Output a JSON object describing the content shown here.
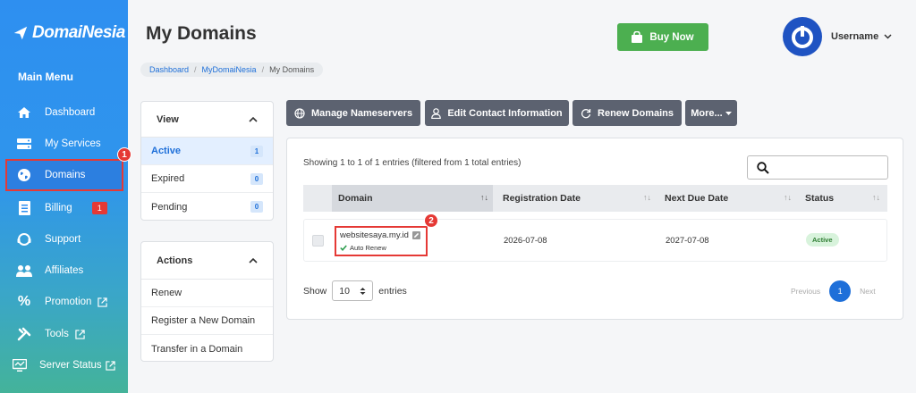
{
  "brand": {
    "name": "DomaiNesia"
  },
  "sidebar": {
    "menu_title": "Main Menu",
    "items": [
      {
        "label": "Dashboard",
        "icon": "home-icon"
      },
      {
        "label": "My Services",
        "icon": "server-icon"
      },
      {
        "label": "Domains",
        "icon": "globe-icon",
        "active": true,
        "step": "1"
      },
      {
        "label": "Billing",
        "icon": "invoice-icon",
        "badge": "1"
      },
      {
        "label": "Support",
        "icon": "support-icon"
      },
      {
        "label": "Affiliates",
        "icon": "users-icon"
      },
      {
        "label": "Promotion",
        "icon": "percent-icon",
        "external": true
      },
      {
        "label": "Tools",
        "icon": "tools-icon",
        "external": true
      },
      {
        "label": "Server Status",
        "icon": "monitor-icon",
        "external": true
      }
    ]
  },
  "header": {
    "title": "My Domains",
    "buy_label": "Buy Now",
    "username": "Username"
  },
  "breadcrumb": [
    "Dashboard",
    "MyDomaiNesia",
    "My Domains"
  ],
  "view_panel": {
    "title": "View",
    "items": [
      {
        "label": "Active",
        "count": "1",
        "selected": true
      },
      {
        "label": "Expired",
        "count": "0"
      },
      {
        "label": "Pending",
        "count": "0"
      }
    ]
  },
  "actions_panel": {
    "title": "Actions",
    "items": [
      "Renew",
      "Register a New Domain",
      "Transfer in a Domain"
    ]
  },
  "toolbar": {
    "manage_ns": "Manage Nameservers",
    "edit_contact": "Edit Contact Information",
    "renew": "Renew Domains",
    "more": "More..."
  },
  "table": {
    "showing": "Showing 1 to 1 of 1 entries (filtered from 1 total entries)",
    "columns": [
      "Domain",
      "Registration Date",
      "Next Due Date",
      "Status"
    ],
    "rows": [
      {
        "domain": "websitesaya.my.id",
        "auto_renew": "Auto Renew",
        "registration_date": "2026-07-08",
        "next_due_date": "2027-07-08",
        "status": "Active",
        "step": "2"
      }
    ],
    "show_label": "Show",
    "page_size": "10",
    "entries_label": "entries",
    "pager": {
      "previous": "Previous",
      "current": "1",
      "next": "Next"
    }
  },
  "colors": {
    "accent": "#1e6fd9",
    "buy": "#4caf50",
    "highlight": "#e53935",
    "toolbar": "#5c6270"
  }
}
